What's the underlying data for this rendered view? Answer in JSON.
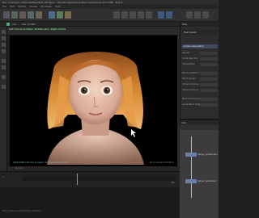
{
  "window": {
    "title": "File: C:/Users/.../Samuel/HairStyle_06.hipnc - Houdini Apprentice Non-Commercial 19.5.368 - Py3.9"
  },
  "menu": [
    "File",
    "Edit",
    "Render",
    "Assets",
    "Windows",
    "Help"
  ],
  "path": {
    "segments": [
      "obj",
      "hair_toolkit"
    ]
  },
  "viewport": {
    "camera_label": "No cam",
    "overlay_text": "Left mouse tumbles. Middle pans. Right dollies.",
    "bottom_text": "1920x1080 Left click to select / shift+left add selection",
    "non_commercial_tag": "Non-Commercial Edition"
  },
  "timeline": {
    "current_frame": "1",
    "end_marker": "240"
  },
  "right_panel": {
    "tab_label": "Tree",
    "header_label": "Hair Groom",
    "section_label": "Guide Interpolation",
    "params": [
      {
        "label": "Density"
      },
      {
        "label": "Guide Selection"
      },
      {
        "label": "Interpolation"
      },
      {
        "label": "Blending Method"
      },
      {
        "label": "Blend Guides"
      },
      {
        "label": "Influence Radius"
      },
      {
        "label": "Influence Decay"
      },
      {
        "label": "Maximum Guide Count"
      },
      {
        "label": "Guide Blend Weight"
      }
    ]
  },
  "network": {
    "tab_label": "/obj",
    "nodes": [
      {
        "label": "hairgen_guidesurface"
      },
      {
        "label": "hairgen_guideinterp"
      }
    ]
  },
  "status": {
    "text": "hair_toolkit_groom_HairStyle_06.hipnc"
  },
  "colors": {
    "accent": "#5a9cff",
    "node": "#6b7fa8",
    "background": "#1f1f1f"
  }
}
